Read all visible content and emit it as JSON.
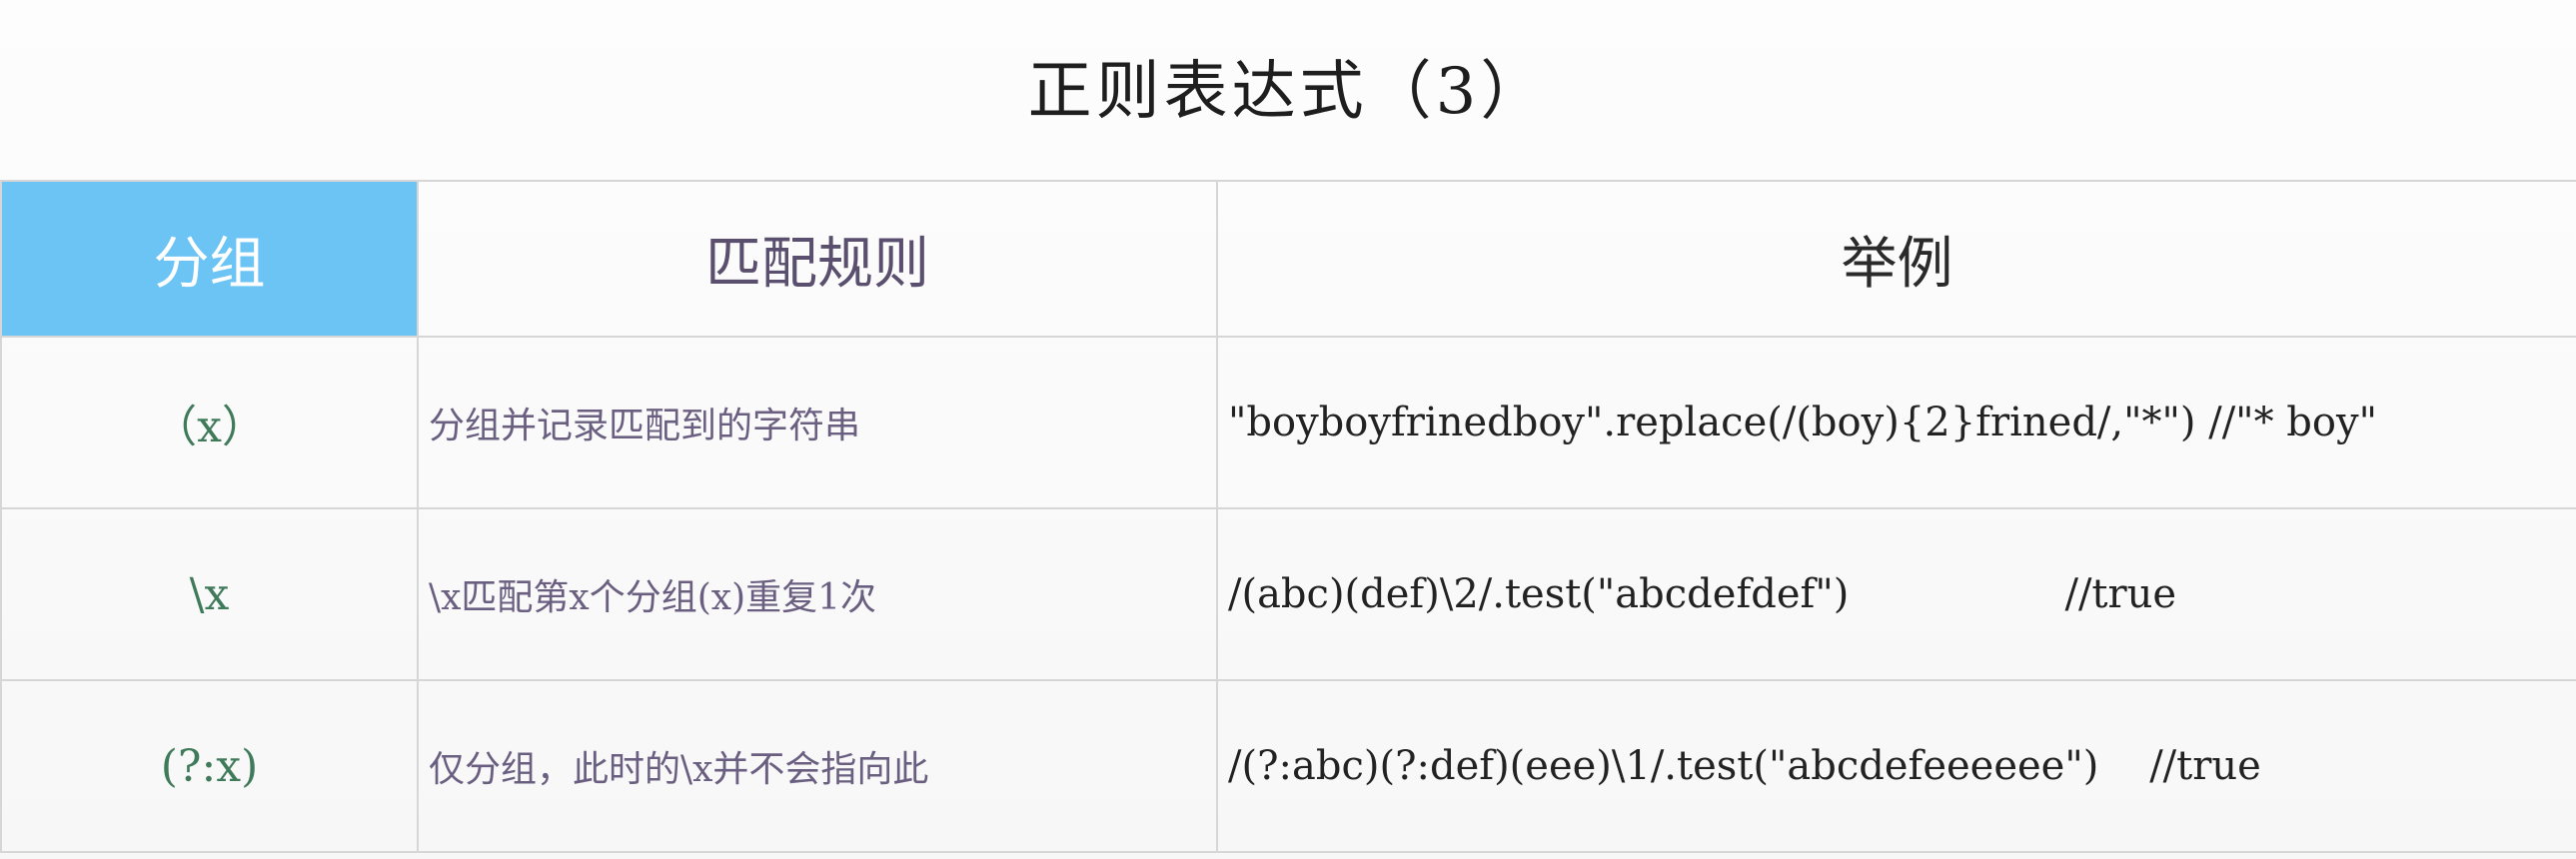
{
  "title": "正则表达式（3）",
  "table": {
    "headers": {
      "group": "分组",
      "rule": "匹配规则",
      "example": "举例"
    },
    "rows": [
      {
        "group": "（x）",
        "rule": "分组并记录匹配到的字符串",
        "example": "\"boyboyfrinedboy\".replace(/(boy){2}frined/,\"*\") //\"* boy\""
      },
      {
        "group": "\\x",
        "rule": "\\x匹配第x个分组(x)重复1次",
        "example": "/(abc)(def)\\2/.test(\"abcdefdef\")                 //true"
      },
      {
        "group": "(?:x)",
        "rule": "仅分组，此时的\\x并不会指向此",
        "example": "/(?:abc)(?:def)(eee)\\1/.test(\"abcdefeeeeee\")    //true"
      }
    ]
  }
}
